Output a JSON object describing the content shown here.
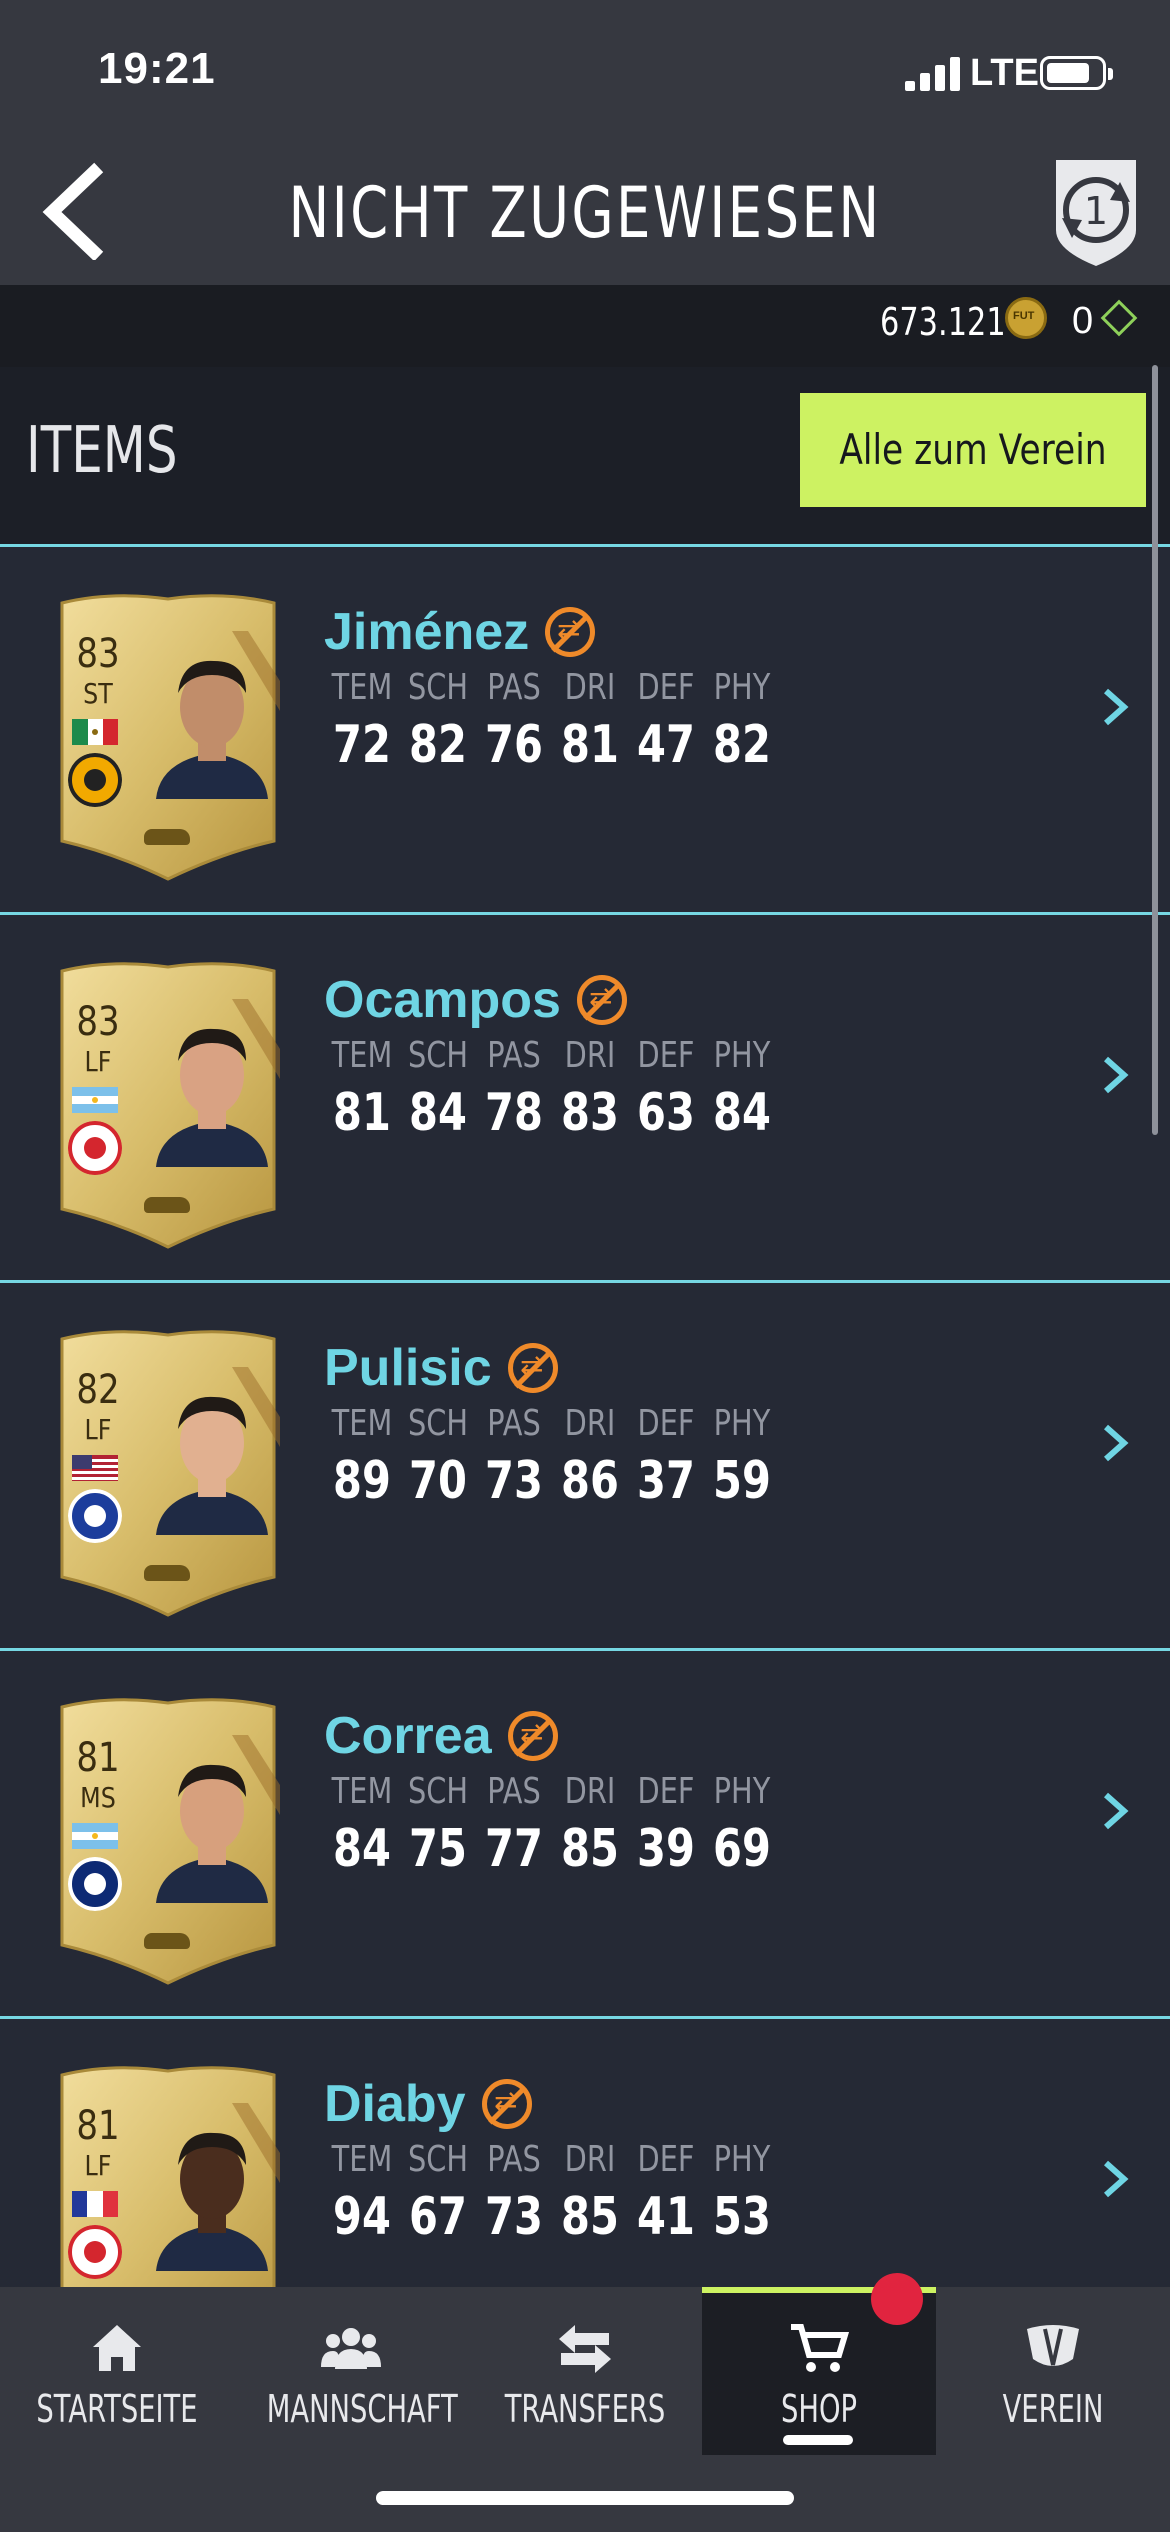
{
  "status_bar": {
    "time": "19:21",
    "network": "LTE"
  },
  "header": {
    "title": "NICHT ZUGEWIESEN",
    "back_icon": "chevron-left-icon",
    "badge_icon": "sbc-refresh-icon",
    "badge_number": "1"
  },
  "currency": {
    "coins": "673.121",
    "coin_icon_text": "FUT",
    "points": "0"
  },
  "section": {
    "label": "ITEMS",
    "button_label": "Alle zum Verein"
  },
  "stat_labels": [
    "TEM",
    "SCH",
    "PAS",
    "DRI",
    "DEF",
    "PHY"
  ],
  "players": [
    {
      "name": "Jiménez",
      "rating": "83",
      "position": "ST",
      "stats": [
        "72",
        "82",
        "76",
        "81",
        "47",
        "82"
      ],
      "nation": "mexico",
      "club": "wolves"
    },
    {
      "name": "Ocampos",
      "rating": "83",
      "position": "LF",
      "stats": [
        "81",
        "84",
        "78",
        "83",
        "63",
        "84"
      ],
      "nation": "argentina",
      "club": "sevilla"
    },
    {
      "name": "Pulisic",
      "rating": "82",
      "position": "LF",
      "stats": [
        "89",
        "70",
        "73",
        "86",
        "37",
        "59"
      ],
      "nation": "usa",
      "club": "chelsea"
    },
    {
      "name": "Correa",
      "rating": "81",
      "position": "MS",
      "stats": [
        "84",
        "75",
        "77",
        "85",
        "39",
        "69"
      ],
      "nation": "argentina",
      "club": "inter"
    },
    {
      "name": "Diaby",
      "rating": "81",
      "position": "LF",
      "stats": [
        "94",
        "67",
        "73",
        "85",
        "41",
        "53"
      ],
      "nation": "france",
      "club": "leverkusen"
    }
  ],
  "tabs": [
    {
      "label": "STARTSEITE",
      "icon": "home-icon"
    },
    {
      "label": "MANNSCHAFT",
      "icon": "team-icon"
    },
    {
      "label": "TRANSFERS",
      "icon": "transfer-arrows-icon"
    },
    {
      "label": "SHOP",
      "icon": "cart-icon",
      "active": true
    },
    {
      "label": "VEREIN",
      "icon": "club-crest-icon"
    }
  ],
  "colors": {
    "accent": "#cdf262",
    "name": "#6fd5e4",
    "untradeable": "#ef8a2a",
    "badge": "#e1243f"
  }
}
